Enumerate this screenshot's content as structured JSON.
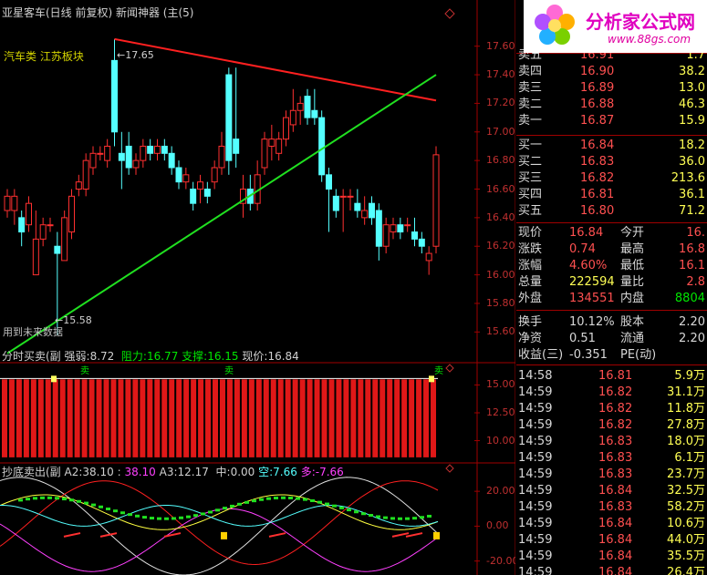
{
  "header": {
    "title": "亚星客车(日线 前复权) 新闻神器 (主(5)",
    "sector": "汽车类 江苏板块",
    "future_note": "用到未来数据"
  },
  "main_chart": {
    "high_label": "17.65",
    "low_label": "15.58",
    "y_ticks": [
      "17.60",
      "17.40",
      "17.20",
      "17.00",
      "16.80",
      "16.60",
      "16.40",
      "16.20",
      "16.00",
      "15.80",
      "15.60"
    ]
  },
  "chart_data": [
    {
      "type": "candlestick",
      "title": "亚星客车(日线 前复权)",
      "ylim": [
        15.5,
        17.7
      ],
      "y_ticks": [
        17.6,
        17.4,
        17.2,
        17.0,
        16.8,
        16.6,
        16.4,
        16.2,
        16.0,
        15.8,
        15.6
      ],
      "candles": [
        {
          "o": 16.45,
          "h": 16.6,
          "l": 16.4,
          "c": 16.55
        },
        {
          "o": 16.45,
          "h": 16.6,
          "l": 16.35,
          "c": 16.55
        },
        {
          "o": 16.4,
          "h": 16.45,
          "l": 16.2,
          "c": 16.3
        },
        {
          "o": 16.35,
          "h": 16.55,
          "l": 16.3,
          "c": 16.5
        },
        {
          "o": 16.0,
          "h": 16.45,
          "l": 16.0,
          "c": 16.25
        },
        {
          "o": 16.25,
          "h": 16.4,
          "l": 16.2,
          "c": 16.35
        },
        {
          "o": 16.35,
          "h": 16.4,
          "l": 16.3,
          "c": 16.35
        },
        {
          "o": 16.2,
          "h": 16.3,
          "l": 15.58,
          "c": 16.15
        },
        {
          "o": 16.1,
          "h": 16.45,
          "l": 16.1,
          "c": 16.4
        },
        {
          "o": 16.3,
          "h": 16.6,
          "l": 16.25,
          "c": 16.55
        },
        {
          "o": 16.6,
          "h": 16.7,
          "l": 16.55,
          "c": 16.65
        },
        {
          "o": 16.6,
          "h": 16.85,
          "l": 16.55,
          "c": 16.8
        },
        {
          "o": 16.75,
          "h": 16.9,
          "l": 16.7,
          "c": 16.85
        },
        {
          "o": 16.85,
          "h": 16.9,
          "l": 16.8,
          "c": 16.85
        },
        {
          "o": 16.8,
          "h": 16.95,
          "l": 16.75,
          "c": 16.9
        },
        {
          "o": 17.5,
          "h": 17.65,
          "l": 16.9,
          "c": 17.0
        },
        {
          "o": 16.85,
          "h": 17.0,
          "l": 16.6,
          "c": 16.8
        },
        {
          "o": 16.9,
          "h": 17.0,
          "l": 16.7,
          "c": 16.75
        },
        {
          "o": 16.75,
          "h": 16.85,
          "l": 16.7,
          "c": 16.8
        },
        {
          "o": 16.8,
          "h": 16.95,
          "l": 16.75,
          "c": 16.9
        },
        {
          "o": 16.9,
          "h": 16.95,
          "l": 16.8,
          "c": 16.85
        },
        {
          "o": 16.85,
          "h": 16.95,
          "l": 16.8,
          "c": 16.9
        },
        {
          "o": 16.9,
          "h": 16.95,
          "l": 16.8,
          "c": 16.85
        },
        {
          "o": 16.85,
          "h": 16.9,
          "l": 16.7,
          "c": 16.75
        },
        {
          "o": 16.75,
          "h": 16.8,
          "l": 16.6,
          "c": 16.65
        },
        {
          "o": 16.65,
          "h": 16.75,
          "l": 16.6,
          "c": 16.7
        },
        {
          "o": 16.6,
          "h": 16.65,
          "l": 16.45,
          "c": 16.5
        },
        {
          "o": 16.6,
          "h": 16.7,
          "l": 16.5,
          "c": 16.65
        },
        {
          "o": 16.6,
          "h": 16.65,
          "l": 16.5,
          "c": 16.55
        },
        {
          "o": 16.65,
          "h": 16.8,
          "l": 16.6,
          "c": 16.75
        },
        {
          "o": 16.75,
          "h": 17.0,
          "l": 16.7,
          "c": 16.9
        },
        {
          "o": 17.4,
          "h": 17.45,
          "l": 16.7,
          "c": 16.8
        },
        {
          "o": 16.95,
          "h": 17.45,
          "l": 16.75,
          "c": 16.85
        },
        {
          "o": 16.5,
          "h": 16.7,
          "l": 16.4,
          "c": 16.6
        },
        {
          "o": 16.6,
          "h": 16.7,
          "l": 16.45,
          "c": 16.5
        },
        {
          "o": 16.5,
          "h": 16.8,
          "l": 16.45,
          "c": 16.7
        },
        {
          "o": 16.75,
          "h": 17.0,
          "l": 16.7,
          "c": 16.95
        },
        {
          "o": 16.9,
          "h": 17.05,
          "l": 16.8,
          "c": 16.95
        },
        {
          "o": 16.85,
          "h": 17.0,
          "l": 16.8,
          "c": 16.95
        },
        {
          "o": 16.95,
          "h": 17.15,
          "l": 16.9,
          "c": 17.1
        },
        {
          "o": 17.05,
          "h": 17.3,
          "l": 17.0,
          "c": 17.15
        },
        {
          "o": 17.15,
          "h": 17.25,
          "l": 17.05,
          "c": 17.2
        },
        {
          "o": 17.25,
          "h": 17.3,
          "l": 17.05,
          "c": 17.1
        },
        {
          "o": 17.15,
          "h": 17.3,
          "l": 17.05,
          "c": 17.1
        },
        {
          "o": 17.1,
          "h": 17.15,
          "l": 16.65,
          "c": 16.7
        },
        {
          "o": 16.7,
          "h": 16.75,
          "l": 16.3,
          "c": 16.6
        },
        {
          "o": 16.55,
          "h": 16.6,
          "l": 16.4,
          "c": 16.45
        },
        {
          "o": 16.55,
          "h": 16.6,
          "l": 16.3,
          "c": 16.55
        },
        {
          "o": 16.55,
          "h": 16.6,
          "l": 16.45,
          "c": 16.55
        },
        {
          "o": 16.5,
          "h": 16.6,
          "l": 16.4,
          "c": 16.45
        },
        {
          "o": 16.4,
          "h": 16.55,
          "l": 16.35,
          "c": 16.45
        },
        {
          "o": 16.5,
          "h": 16.55,
          "l": 16.35,
          "c": 16.4
        },
        {
          "o": 16.45,
          "h": 16.5,
          "l": 16.1,
          "c": 16.2
        },
        {
          "o": 16.2,
          "h": 16.4,
          "l": 16.15,
          "c": 16.35
        },
        {
          "o": 16.3,
          "h": 16.4,
          "l": 16.25,
          "c": 16.35
        },
        {
          "o": 16.35,
          "h": 16.4,
          "l": 16.25,
          "c": 16.3
        },
        {
          "o": 16.35,
          "h": 16.4,
          "l": 16.3,
          "c": 16.35
        },
        {
          "o": 16.3,
          "h": 16.4,
          "l": 16.2,
          "c": 16.25
        },
        {
          "o": 16.25,
          "h": 16.3,
          "l": 16.15,
          "c": 16.2
        },
        {
          "o": 16.1,
          "h": 16.2,
          "l": 16.0,
          "c": 16.15
        },
        {
          "o": 16.2,
          "h": 16.9,
          "l": 16.15,
          "c": 16.84
        }
      ],
      "trend_lines": [
        {
          "name": "resistance",
          "color": "#ff2020",
          "from": [
            15,
            17.65
          ],
          "to": [
            60,
            17.22
          ]
        },
        {
          "name": "support",
          "color": "#20e020",
          "from": [
            0,
            15.45
          ],
          "to": [
            60,
            17.4
          ]
        }
      ]
    },
    {
      "type": "bar",
      "title": "分时买卖(副",
      "ylim": [
        8.0,
        17.0
      ],
      "y_ticks": [
        15.0,
        12.5,
        10.0
      ],
      "bar_top": 15.5,
      "bar_bottom": 8.5,
      "bar_count": 60
    },
    {
      "type": "line",
      "title": "抄底卖出(副",
      "ylim": [
        -28,
        30
      ],
      "y_ticks": [
        20.0,
        0.0,
        -20.0
      ]
    }
  ],
  "sub1": {
    "name": "分时买卖(副",
    "strength_label": "强弱:",
    "strength_value": "8.72",
    "resistance_label": "阻力:",
    "resistance_value": "16.77",
    "support_label": "支撑:",
    "support_value": "16.15",
    "price_label": "现价:",
    "price_value": "16.84",
    "buy_mark": "卖",
    "buy_mark2": "卖",
    "buy_mark3": "卖",
    "y_ticks": [
      "15.00",
      "12.50",
      "10.00"
    ]
  },
  "sub2": {
    "name": "抄底卖出(副",
    "a2_label": "A2:",
    "a2_value": "38.10",
    "a2b_value": "38.10",
    "a3_label": "A3:",
    "a3_value": "12.17",
    "mid_label": "中:",
    "mid_value": "0.00",
    "empty_label": "空:",
    "empty_value": "7.66",
    "many_label": "多:",
    "many_value": "-7.66",
    "y_ticks": [
      "20.00",
      "0.00",
      "-20.00"
    ]
  },
  "logo": {
    "brand": "分析家公式网",
    "url": "www.88gs.com"
  },
  "order_book": {
    "sell": [
      {
        "label": "卖五",
        "price": "16.91",
        "vol": "1.7"
      },
      {
        "label": "卖四",
        "price": "16.90",
        "vol": "38.2"
      },
      {
        "label": "卖三",
        "price": "16.89",
        "vol": "13.0"
      },
      {
        "label": "卖二",
        "price": "16.88",
        "vol": "46.3"
      },
      {
        "label": "卖一",
        "price": "16.87",
        "vol": "15.9"
      }
    ],
    "buy": [
      {
        "label": "买一",
        "price": "16.84",
        "vol": "18.2"
      },
      {
        "label": "买二",
        "price": "16.83",
        "vol": "36.0"
      },
      {
        "label": "买三",
        "price": "16.82",
        "vol": "213.6"
      },
      {
        "label": "买四",
        "price": "16.81",
        "vol": "36.1"
      },
      {
        "label": "买五",
        "price": "16.80",
        "vol": "71.2"
      }
    ]
  },
  "quote": {
    "rows": [
      {
        "l1": "现价",
        "v1": "16.84",
        "l2": "今开",
        "v2": "16."
      },
      {
        "l1": "涨跌",
        "v1": "0.74",
        "l2": "最高",
        "v2": "16.8"
      },
      {
        "l1": "涨幅",
        "v1": "4.60%",
        "l2": "最低",
        "v2": "16.1"
      },
      {
        "l1": "总量",
        "v1": "222594",
        "l2": "量比",
        "v2": "2.8"
      },
      {
        "l1": "外盘",
        "v1": "134551",
        "l2": "内盘",
        "v2": "8804"
      }
    ],
    "rows2": [
      {
        "l1": "换手",
        "v1": "10.12%",
        "l2": "股本",
        "v2": "2.20"
      },
      {
        "l1": "净资",
        "v1": "0.51",
        "l2": "流通",
        "v2": "2.20"
      },
      {
        "l1": "收益(三)",
        "v1": "-0.351",
        "l2": "PE(动)",
        "v2": ""
      }
    ]
  },
  "ticks": [
    {
      "time": "14:58",
      "price": "16.81",
      "vol": "5.9万"
    },
    {
      "time": "14:59",
      "price": "16.82",
      "vol": "31.1万"
    },
    {
      "time": "14:59",
      "price": "16.82",
      "vol": "11.8万"
    },
    {
      "time": "14:59",
      "price": "16.82",
      "vol": "27.8万"
    },
    {
      "time": "14:59",
      "price": "16.83",
      "vol": "18.0万"
    },
    {
      "time": "14:59",
      "price": "16.83",
      "vol": "6.1万"
    },
    {
      "time": "14:59",
      "price": "16.83",
      "vol": "23.7万"
    },
    {
      "time": "14:59",
      "price": "16.84",
      "vol": "32.5万"
    },
    {
      "time": "14:59",
      "price": "16.83",
      "vol": "58.2万"
    },
    {
      "time": "14:59",
      "price": "16.84",
      "vol": "10.6万"
    },
    {
      "time": "14:59",
      "price": "16.84",
      "vol": "44.0万"
    },
    {
      "time": "14:59",
      "price": "16.84",
      "vol": "35.5万"
    },
    {
      "time": "14:59",
      "price": "16.84",
      "vol": "26.4万"
    }
  ],
  "colors": {
    "up": "#54ffff",
    "down": "#ff3030",
    "resistance": "#ff2020",
    "support": "#20e020",
    "frame": "#a00000",
    "bg": "#000000"
  }
}
